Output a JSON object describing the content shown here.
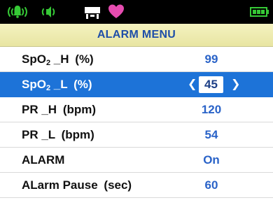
{
  "status_bar": {
    "icons": [
      "alarm-sound-icon",
      "speaker-icon",
      "wireless-icon",
      "heart-icon",
      "battery-icon"
    ],
    "colors": {
      "icon_green": "#36c936",
      "heart": "#e64cb0",
      "background": "#000000"
    }
  },
  "menu": {
    "title": "ALARM MENU",
    "items": [
      {
        "name": "SpO",
        "sub": "2",
        "suffix": " _H",
        "unit": "(%)",
        "value": "99"
      },
      {
        "name": "SpO",
        "sub": "2",
        "suffix": " _L",
        "unit": "(%)",
        "value": "45",
        "selected": true
      },
      {
        "name": "PR _H",
        "unit": "(bpm)",
        "value": "120"
      },
      {
        "name": "PR _L",
        "unit": "(bpm)",
        "value": "54"
      },
      {
        "name": "ALARM",
        "value": "On"
      },
      {
        "name": "ALarm Pause",
        "unit": "(sec)",
        "value": "60"
      }
    ]
  },
  "colors": {
    "title_text": "#1f4fa8",
    "selected_row": "#1d73d8",
    "value_text": "#2a63c8"
  }
}
